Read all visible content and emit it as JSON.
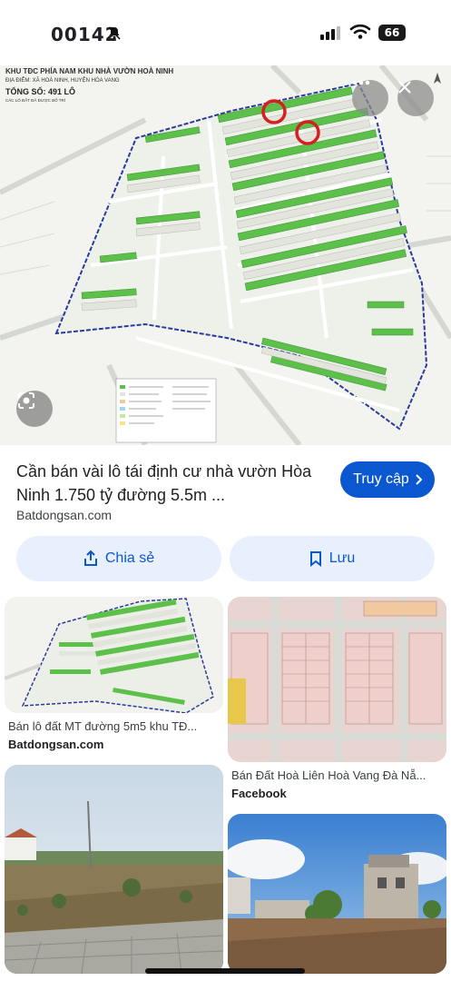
{
  "status_bar": {
    "time": "00142",
    "battery": "66"
  },
  "hero": {
    "map_title": "KHU TĐC PHÍA NAM KHU NHÀ VƯỜN HOÀ NINH",
    "map_subtitle": "ĐỊA ĐIỂM: XÃ HOÀ NINH, HUYỆN HÒA VANG",
    "map_total": "TỔNG SỐ: 491 LÔ",
    "map_note": "CÁC LÔ ĐẤT ĐÃ ĐƯỢC BỐ TRÍ"
  },
  "result": {
    "title": "Cần bán vài lô tái định cư nhà vườn Hòa Ninh 1.750 tỷ đường 5.5m ...",
    "source": "Batdongsan.com",
    "visit_label": "Truy cập",
    "share_label": "Chia sẻ",
    "save_label": "Lưu"
  },
  "related": [
    {
      "caption": "Bán lô đất MT đường 5m5 khu TĐ...",
      "source": "Batdongsan.com"
    },
    {
      "caption": "Bán Đất Hoà Liên Hoà Vang Đà Nẵ...",
      "source": "Facebook"
    }
  ],
  "colors": {
    "accent": "#0b57d0",
    "chip_bg": "#e8f0fe",
    "lot_green": "#5cc04a",
    "boundary": "#2b3a9c",
    "marker_red": "#d32020"
  }
}
